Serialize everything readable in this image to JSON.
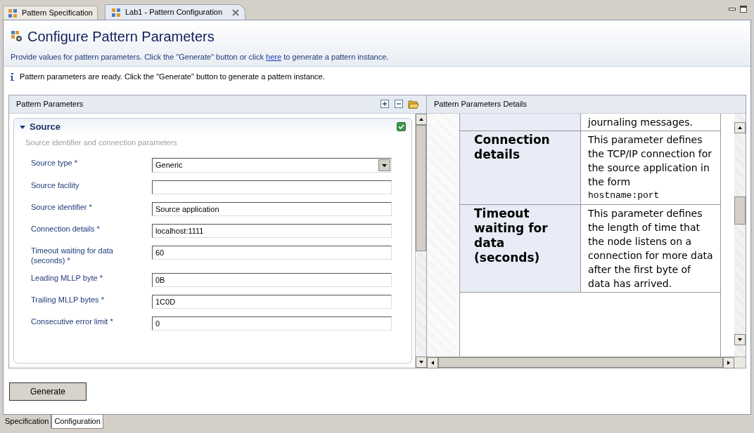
{
  "editor_tabs": [
    {
      "label": "Pattern Specification",
      "selected": false,
      "closable": false
    },
    {
      "label": "Lab1 - Pattern Configuration",
      "selected": true,
      "closable": true
    }
  ],
  "header": {
    "title": "Configure Pattern Parameters",
    "instruction_before": "Provide values for pattern parameters. Click the \"Generate\" button or click",
    "link": "here",
    "instruction_after": "to generate a pattern instance."
  },
  "info_message": "Pattern parameters are ready. Click the \"Generate\" button to generate a pattern instance.",
  "parameters_panel": {
    "title": "Pattern Parameters",
    "section": {
      "title": "Source",
      "expanded": true,
      "valid": true,
      "description": "Source identifier and connection parameters",
      "fields": [
        {
          "label": "Source type *",
          "kind": "select",
          "value": "Generic"
        },
        {
          "label": "Source facility",
          "kind": "text"
        },
        {
          "label": "Source identifier *",
          "kind": "text",
          "value": "Source application"
        },
        {
          "label": "Connection details *",
          "kind": "text",
          "value": "localhost:1111"
        },
        {
          "label": "Timeout waiting for data (seconds) *",
          "kind": "text",
          "value": "60"
        },
        {
          "label": "Leading MLLP byte *",
          "kind": "text",
          "value": "0B"
        },
        {
          "label": "Trailing MLLP bytes *",
          "kind": "text",
          "value": "1C0D"
        },
        {
          "label": "Consecutive error limit *",
          "kind": "text",
          "value": "0"
        }
      ]
    }
  },
  "details_panel": {
    "title": "Pattern Parameters Details",
    "rows": [
      {
        "description": "journaling messages."
      },
      {
        "parameter": "Connection details",
        "description": "This parameter defines the TCP/IP connection for the source application in the form",
        "code": "hostname:port"
      },
      {
        "parameter": "Timeout waiting for data (seconds)",
        "description": "This parameter defines the length of time that the node listens on a connection for more data after the first byte of data has arrived."
      }
    ]
  },
  "generate_button": "Generate",
  "bottom_tabs": [
    {
      "label": "Specification",
      "selected": false
    },
    {
      "label": "Configuration",
      "selected": true
    }
  ]
}
